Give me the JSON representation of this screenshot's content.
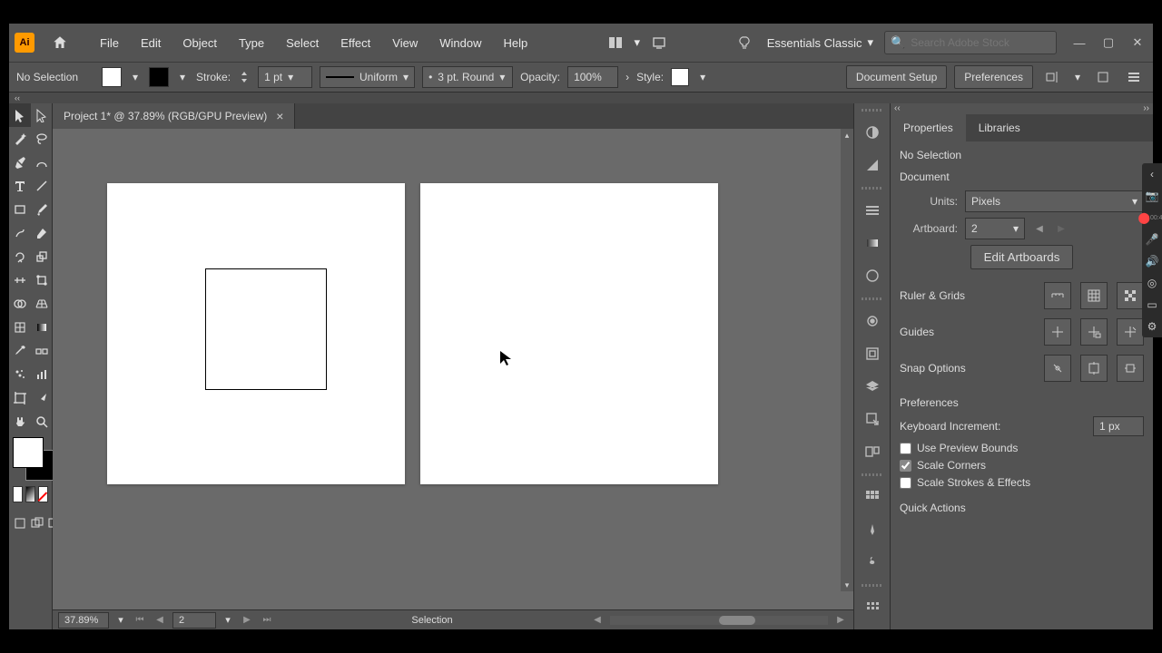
{
  "menubar": {
    "items": [
      "File",
      "Edit",
      "Object",
      "Type",
      "Select",
      "Effect",
      "View",
      "Window",
      "Help"
    ],
    "workspace": "Essentials Classic",
    "search_placeholder": "Search Adobe Stock"
  },
  "controlbar": {
    "selection": "No Selection",
    "stroke_label": "Stroke:",
    "stroke_weight": "1 pt",
    "stroke_profile": "Uniform",
    "brush": "3 pt. Round",
    "opacity_label": "Opacity:",
    "opacity": "100%",
    "style_label": "Style:",
    "doc_setup": "Document Setup",
    "prefs": "Preferences"
  },
  "document": {
    "tab_title": "Project 1* @ 37.89% (RGB/GPU Preview)"
  },
  "statusbar": {
    "zoom": "37.89%",
    "artboard": "2",
    "tool": "Selection"
  },
  "properties": {
    "tabs": {
      "properties": "Properties",
      "libraries": "Libraries"
    },
    "no_selection": "No Selection",
    "document_label": "Document",
    "units_label": "Units:",
    "units_value": "Pixels",
    "artboard_label": "Artboard:",
    "artboard_value": "2",
    "edit_artboards": "Edit Artboards",
    "ruler_grids": "Ruler & Grids",
    "guides": "Guides",
    "snap_options": "Snap Options",
    "preferences": "Preferences",
    "kb_increment_label": "Keyboard Increment:",
    "kb_increment_value": "1 px",
    "use_preview_bounds": "Use Preview Bounds",
    "scale_corners": "Scale Corners",
    "scale_strokes": "Scale Strokes & Effects",
    "quick_actions": "Quick Actions"
  }
}
